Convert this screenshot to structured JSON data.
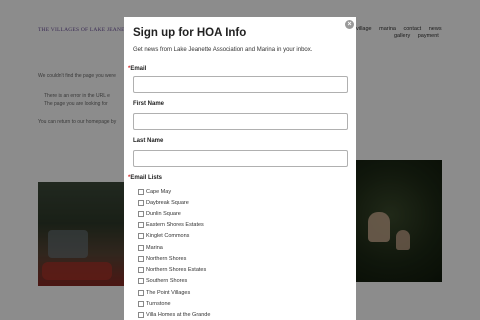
{
  "background": {
    "site_title": "THE VILLAGES OF LAKE JEANETTE",
    "nav_row1": [
      "village",
      "marina",
      "contact",
      "news"
    ],
    "nav_row2": [
      "gallery",
      "payment"
    ],
    "not_found_text": "We couldn't find the page you were",
    "bullet1": "There is an error in the URL e",
    "bullet2": "The page you are looking for",
    "return_text": "You can return to our homepage by"
  },
  "modal": {
    "close_symbol": "×",
    "title": "Sign up for HOA Info",
    "description": "Get news from Lake Jeanette Association and Marina in your inbox.",
    "required_marker": "*",
    "email_label": "Email",
    "email_value": "",
    "first_name_label": "First Name",
    "first_name_value": "",
    "last_name_label": "Last Name",
    "last_name_value": "",
    "email_lists_label": "Email Lists",
    "email_lists": [
      "Cape May",
      "Daybreak Square",
      "Dunlin Square",
      "Eastern Shores Estates",
      "Kinglet Commons",
      "Marina",
      "Northern Shores",
      "Northern Shores Estates",
      "Southern Shores",
      "The Point Villages",
      "Turnstone",
      "Villa Homes at the Grande"
    ]
  },
  "colors": {
    "overlay": "#000000",
    "required": "#d12a2a",
    "site_title": "#6b4f9a"
  }
}
